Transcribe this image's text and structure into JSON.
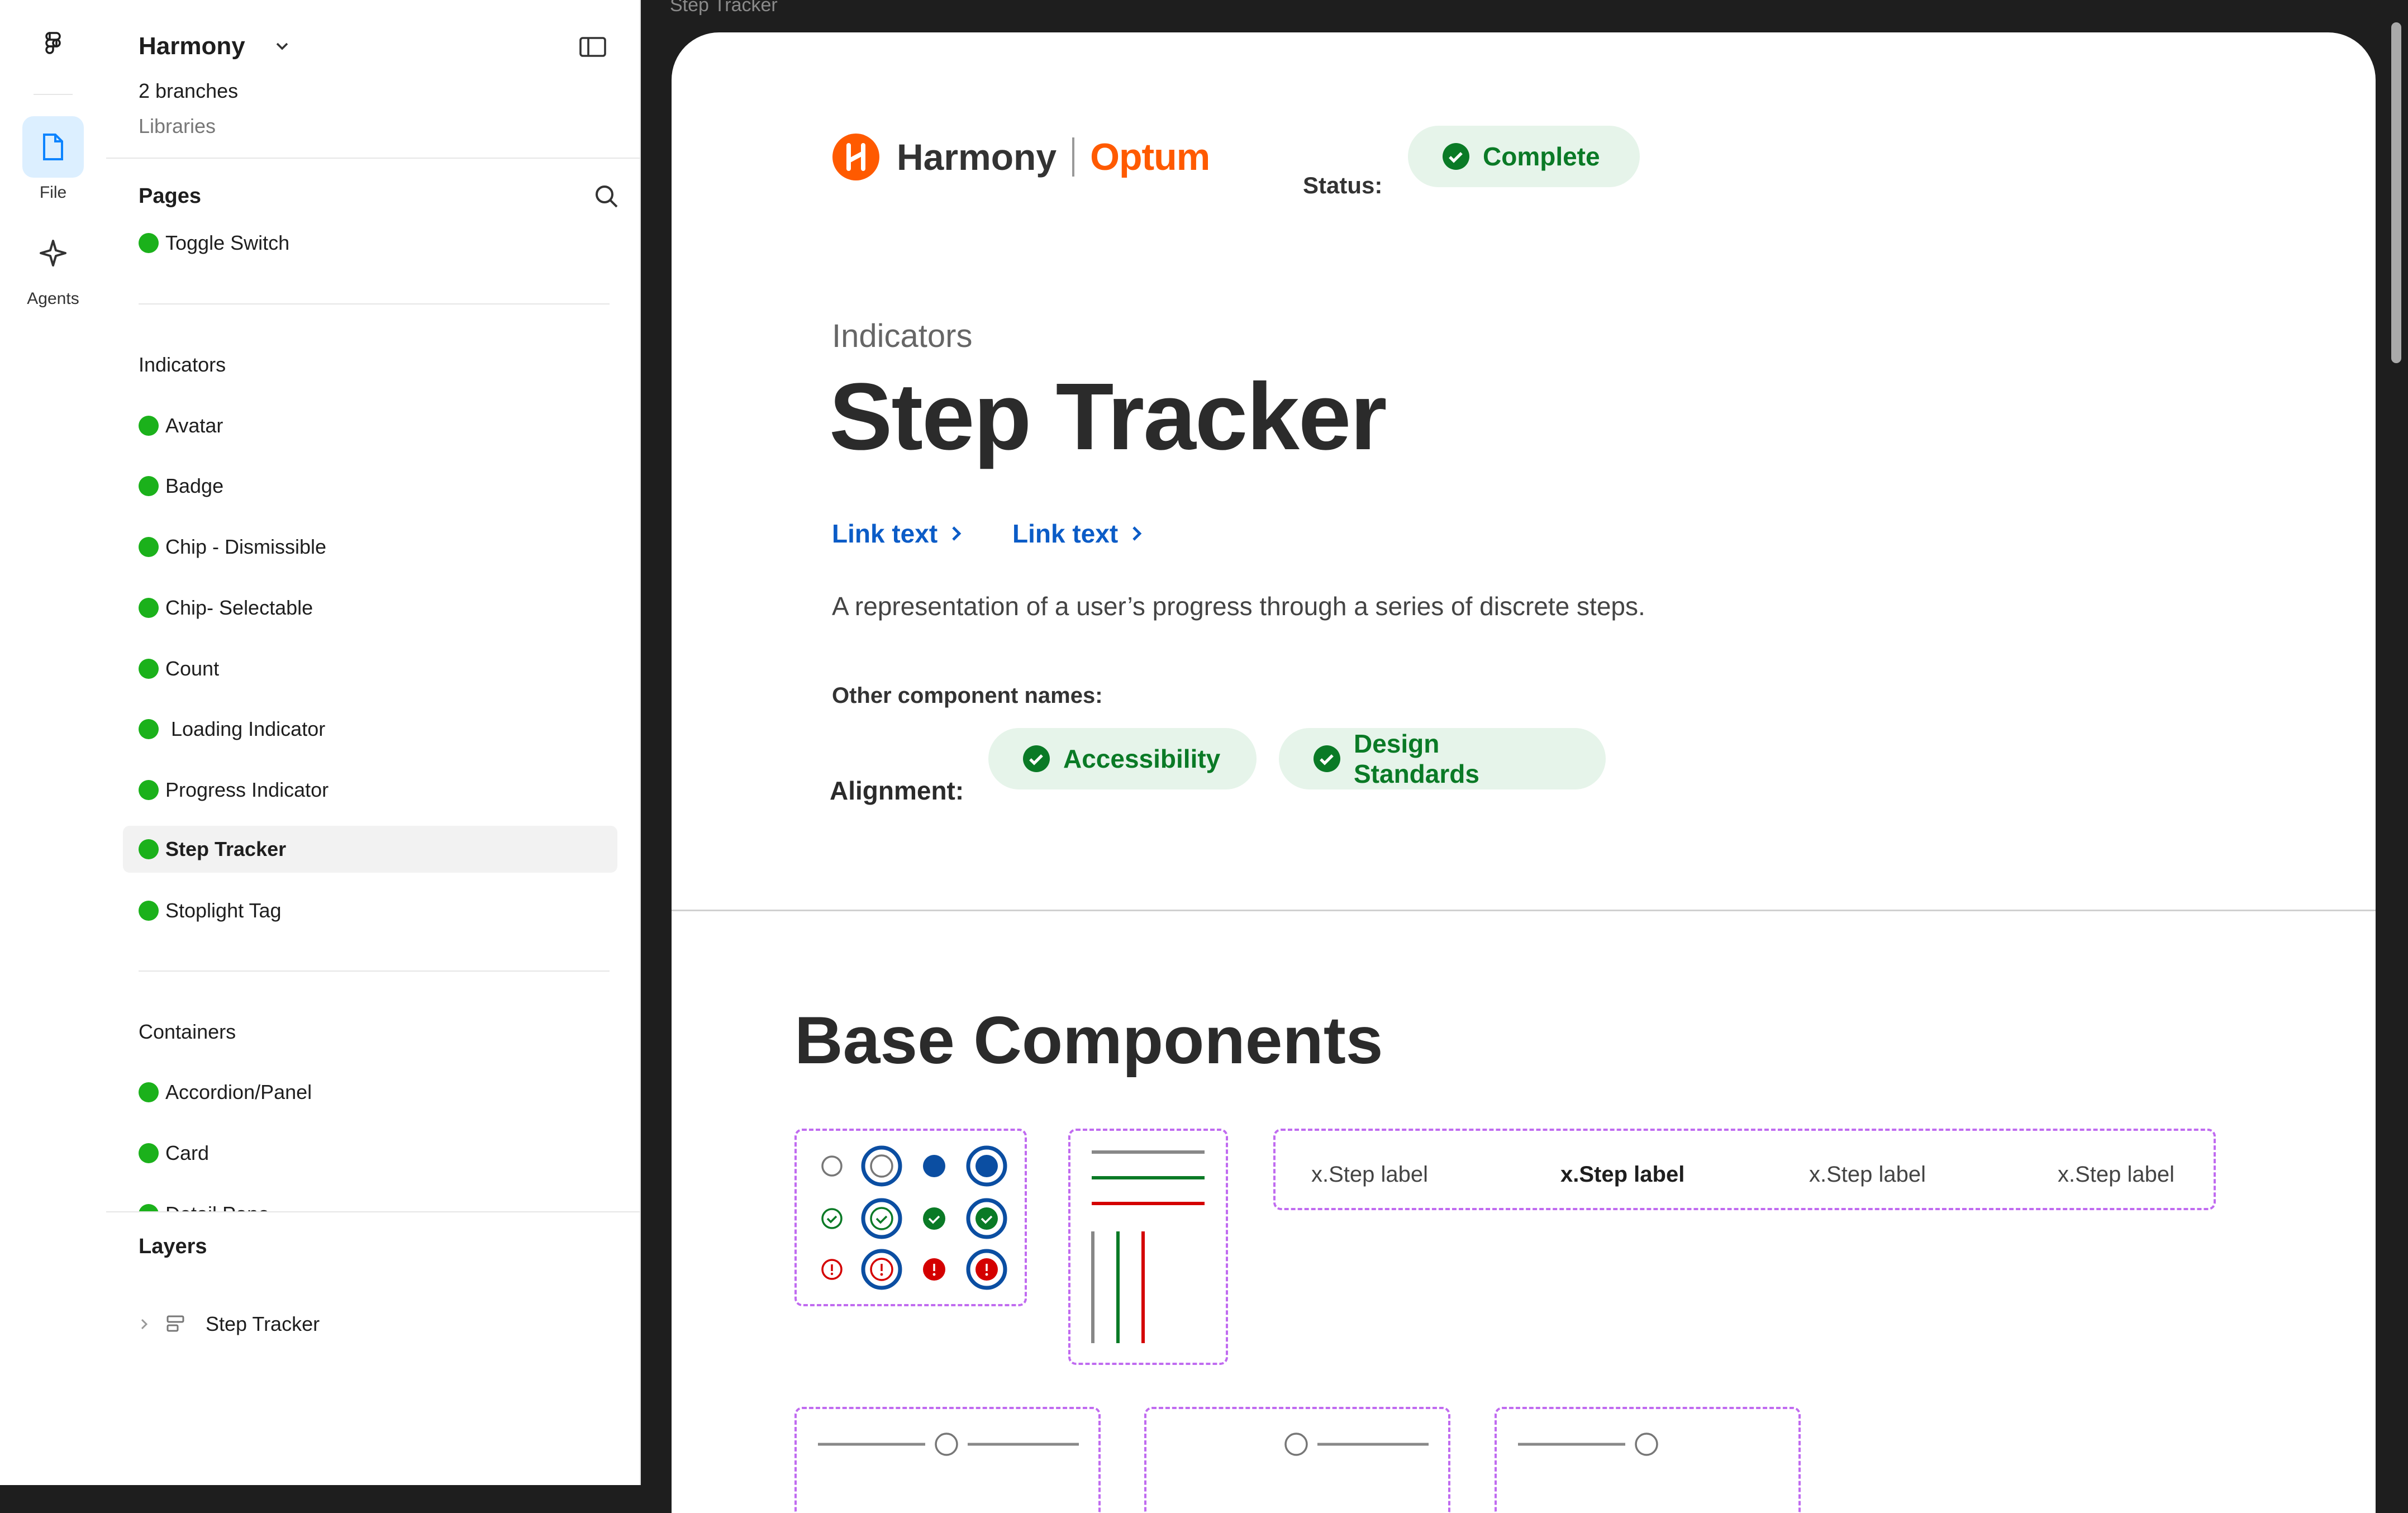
{
  "rail": {
    "file_label": "File",
    "agents_label": "Agents"
  },
  "sidebar": {
    "title": "Harmony",
    "branches": "2 branches",
    "libraries": "Libraries",
    "pages_heading": "Pages",
    "pages": [
      {
        "label": "Toggle Switch"
      }
    ],
    "indicators_heading": "Indicators",
    "indicators": [
      {
        "label": "Avatar"
      },
      {
        "label": "Badge"
      },
      {
        "label": "Chip - Dismissible"
      },
      {
        "label": "Chip- Selectable"
      },
      {
        "label": "Count"
      },
      {
        "label": " Loading Indicator"
      },
      {
        "label": "Progress Indicator"
      },
      {
        "label": "Step Tracker"
      },
      {
        "label": "Stoplight Tag"
      }
    ],
    "containers_heading": "Containers",
    "containers": [
      {
        "label": "Accordion/Panel"
      },
      {
        "label": "Card"
      },
      {
        "label": "Detail Pane"
      }
    ],
    "layers_heading": "Layers",
    "layer": "Step Tracker"
  },
  "canvas": {
    "frame_label": "Step Tracker",
    "brand_name": "Harmony",
    "brand_partner": "Optum",
    "status_label": "Status:",
    "status_value": "Complete",
    "category": "Indicators",
    "title": "Step Tracker",
    "links": [
      "Link text",
      "Link text"
    ],
    "description": "A representation of a user’s progress through a series of discrete steps.",
    "other_names_label": "Other component names:",
    "alignment_label": "Alignment:",
    "alignment": [
      "Accessibility",
      "Design Standards"
    ],
    "section_title": "Base Components",
    "step_labels": [
      "x.Step label",
      "x.Step label",
      "x.Step label",
      "x.Step label"
    ]
  },
  "colors": {
    "accent_blue": "#0b5cc7",
    "success_green": "#0a7a26",
    "success_bg": "#e6f4ea",
    "brand_orange": "#ff5a00",
    "error_red": "#d40000",
    "dashed_purple": "#c06bf0",
    "page_dot_green": "#1bb11b"
  }
}
